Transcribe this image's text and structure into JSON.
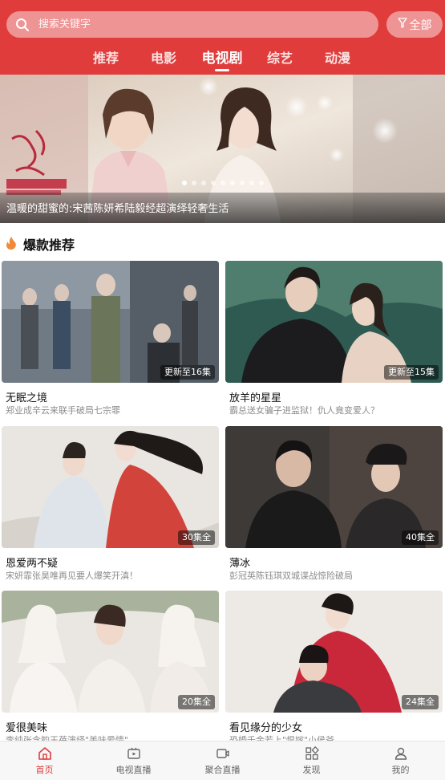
{
  "header": {
    "search_placeholder": "搜索关键字",
    "filter_label": "全部",
    "tabs": [
      {
        "label": "推荐",
        "active": false
      },
      {
        "label": "电影",
        "active": false
      },
      {
        "label": "电视剧",
        "active": true
      },
      {
        "label": "综艺",
        "active": false
      },
      {
        "label": "动漫",
        "active": false
      }
    ]
  },
  "banner": {
    "caption": "温暖的甜蜜的:宋茜陈妍希陆毅经超演绎轻奢生活",
    "dot_count": 9,
    "active_dot": 0
  },
  "section": {
    "title": "爆款推荐",
    "icon": "fire-icon"
  },
  "shows": [
    {
      "title": "无眠之境",
      "desc": "郑业成辛云来联手破局七宗罪",
      "badge": "更新至16集"
    },
    {
      "title": "放羊的星星",
      "desc": "霸总送女骗子进监狱！仇人竟变爱人？",
      "badge": "更新至15集"
    },
    {
      "title": "恩爱两不疑",
      "desc": "宋妍霏张昊唯再见要人爆笑开滇！",
      "badge": "30集全"
    },
    {
      "title": "薄冰",
      "desc": "彭冠英陈钰琪双城谍战惊险破局",
      "badge": "40集全"
    },
    {
      "title": "爱很美味",
      "desc": "李纯张含韵王蓓演绎\"美味爱情\"",
      "badge": "20集全"
    },
    {
      "title": "看见缘分的少女",
      "desc": "恐婚千金若上\"恨嫁\"小侯爷",
      "badge": "24集全"
    }
  ],
  "bottom_nav": [
    {
      "label": "首页",
      "icon": "home-icon",
      "active": true
    },
    {
      "label": "电视直播",
      "icon": "tv-live-icon",
      "active": false
    },
    {
      "label": "聚合直播",
      "icon": "live-stream-icon",
      "active": false
    },
    {
      "label": "发现",
      "icon": "discover-icon",
      "active": false
    },
    {
      "label": "我的",
      "icon": "profile-icon",
      "active": false
    }
  ],
  "colors": {
    "brand": "#e03c3c",
    "text": "#111111",
    "muted": "#8c8c8c"
  }
}
